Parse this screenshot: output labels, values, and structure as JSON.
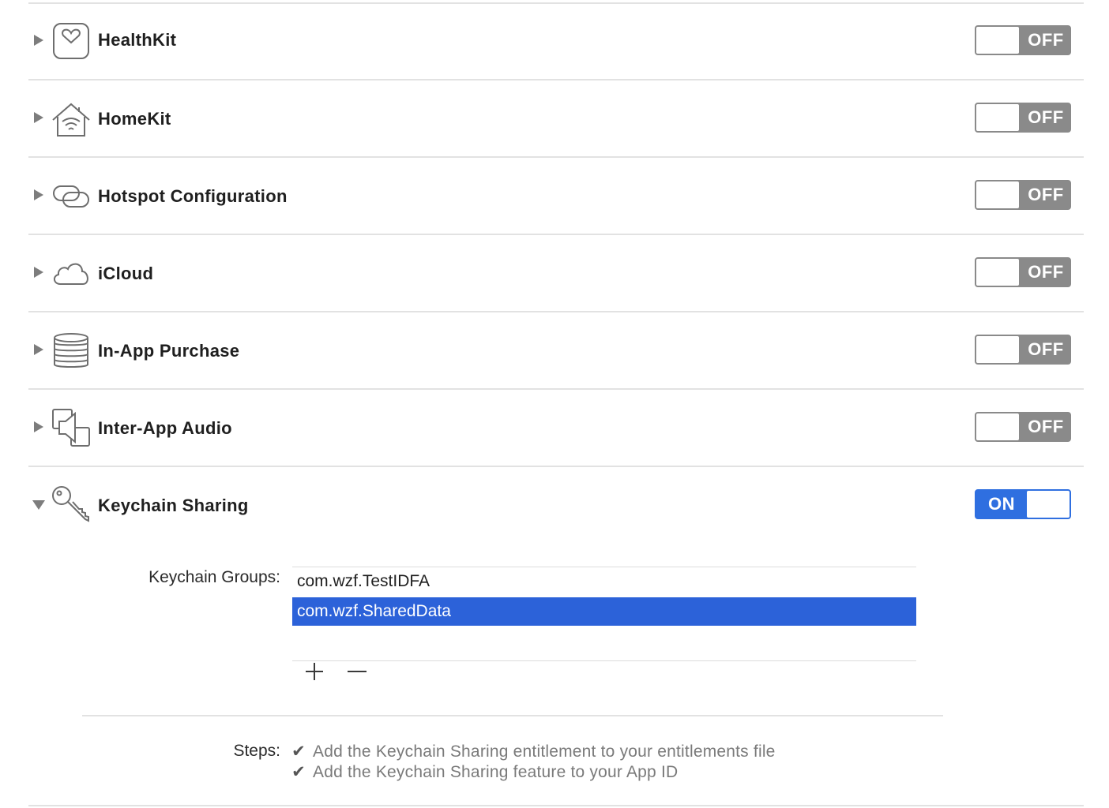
{
  "capabilities": [
    {
      "title": "HealthKit",
      "icon": "heart-icon",
      "toggle": "OFF",
      "expanded": false
    },
    {
      "title": "HomeKit",
      "icon": "house-icon",
      "toggle": "OFF",
      "expanded": false
    },
    {
      "title": "Hotspot Configuration",
      "icon": "hotspot-icon",
      "toggle": "OFF",
      "expanded": false
    },
    {
      "title": "iCloud",
      "icon": "cloud-icon",
      "toggle": "OFF",
      "expanded": false
    },
    {
      "title": "In-App Purchase",
      "icon": "coins-icon",
      "toggle": "OFF",
      "expanded": false
    },
    {
      "title": "Inter-App Audio",
      "icon": "audio-icon",
      "toggle": "OFF",
      "expanded": false
    },
    {
      "title": "Keychain Sharing",
      "icon": "key-icon",
      "toggle": "ON",
      "expanded": true
    }
  ],
  "keychain": {
    "groups_label": "Keychain Groups:",
    "groups": [
      {
        "value": "com.wzf.TestIDFA",
        "selected": false
      },
      {
        "value": "com.wzf.SharedData",
        "selected": true
      }
    ],
    "add_label": "+",
    "remove_label": "−",
    "steps_label": "Steps:",
    "steps": [
      {
        "check": "✔",
        "text": "Add the Keychain Sharing entitlement to your entitlements file"
      },
      {
        "check": "✔",
        "text": "Add the Keychain Sharing feature to your App ID"
      }
    ]
  },
  "colors": {
    "toggle_on": "#2f6fe0",
    "toggle_off": "#8a8a8a",
    "selection": "#2c62d9"
  }
}
